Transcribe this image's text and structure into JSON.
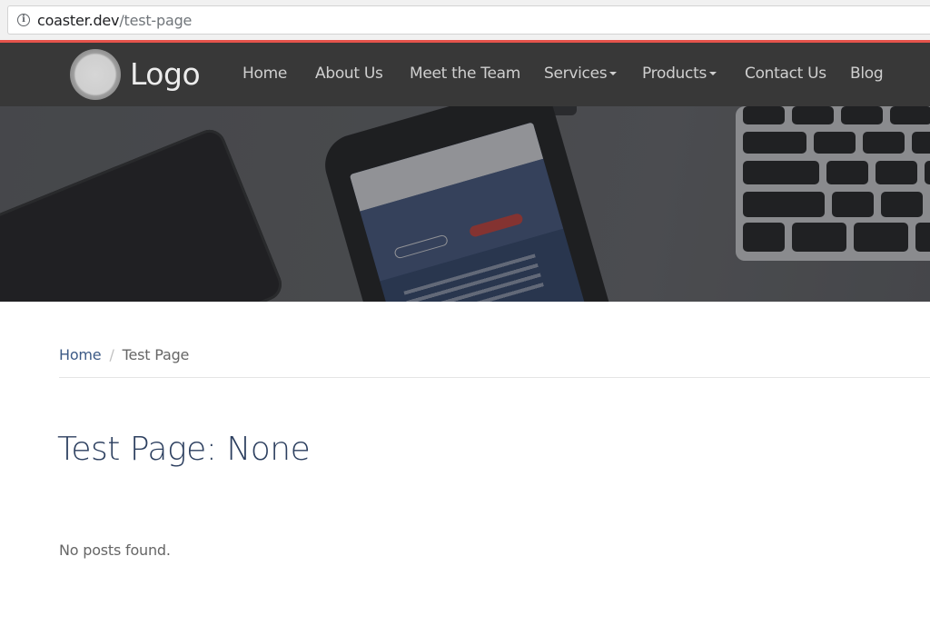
{
  "browser": {
    "url_host": "coaster.dev",
    "url_path": "/test-page"
  },
  "navbar": {
    "logo_text": "Logo",
    "items": [
      {
        "label": "Home",
        "dropdown": false
      },
      {
        "label": "About Us",
        "dropdown": false
      },
      {
        "label": "Meet the Team",
        "dropdown": false
      },
      {
        "label": "Services",
        "dropdown": true
      },
      {
        "label": "Products",
        "dropdown": true
      },
      {
        "label": "Contact Us",
        "dropdown": false
      },
      {
        "label": "Blog",
        "dropdown": false
      }
    ]
  },
  "breadcrumb": {
    "home": "Home",
    "separator": "/",
    "current": "Test Page"
  },
  "page": {
    "title": "Test Page: None",
    "empty_message": "No posts found."
  },
  "colors": {
    "accent_strip": "#e5534b",
    "navbar_bg": "#383838",
    "link": "#3c5a86",
    "title": "#2c3f5f"
  },
  "icons": {
    "address_bar": "info-icon",
    "logo": "logo-circle-icon",
    "dropdown": "caret-down-icon"
  }
}
